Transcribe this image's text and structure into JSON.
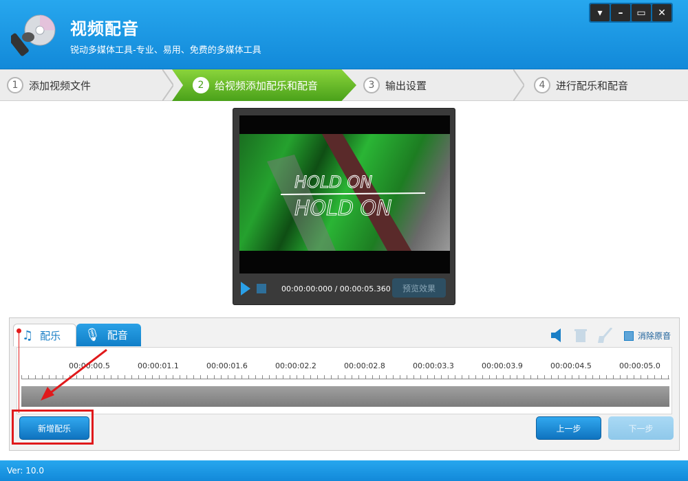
{
  "app": {
    "title": "视频配音",
    "subtitle": "锐动多媒体工具-专业、易用、免费的多媒体工具"
  },
  "window_controls": [
    "dropdown-icon",
    "minimize-icon",
    "maximize-icon",
    "close-icon"
  ],
  "steps": [
    {
      "num": "1",
      "label": "添加视频文件",
      "active": false
    },
    {
      "num": "2",
      "label": "给视频添加配乐和配音",
      "active": true
    },
    {
      "num": "3",
      "label": "输出设置",
      "active": false
    },
    {
      "num": "4",
      "label": "进行配乐和配音",
      "active": false
    }
  ],
  "player": {
    "time": "00:00:00:000 / 00:00:05.360",
    "preview_label": "预览效果"
  },
  "tabs": {
    "music": "配乐",
    "voice": "配音"
  },
  "tools": {
    "remove_original": "消除原音"
  },
  "timeline": {
    "ticks": [
      "00:00:00.5",
      "00:00:01.1",
      "00:00:01.6",
      "00:00:02.2",
      "00:00:02.8",
      "00:00:03.3",
      "00:00:03.9",
      "00:00:04.5",
      "00:00:05.0"
    ]
  },
  "buttons": {
    "add_music": "新增配乐",
    "prev": "上一步",
    "next": "下一步"
  },
  "footer": {
    "version": "Ver: 10.0"
  },
  "colors": {
    "accent_blue": "#1289d9",
    "active_step_green": "#4aa11a",
    "highlight_red": "#e0191b"
  }
}
